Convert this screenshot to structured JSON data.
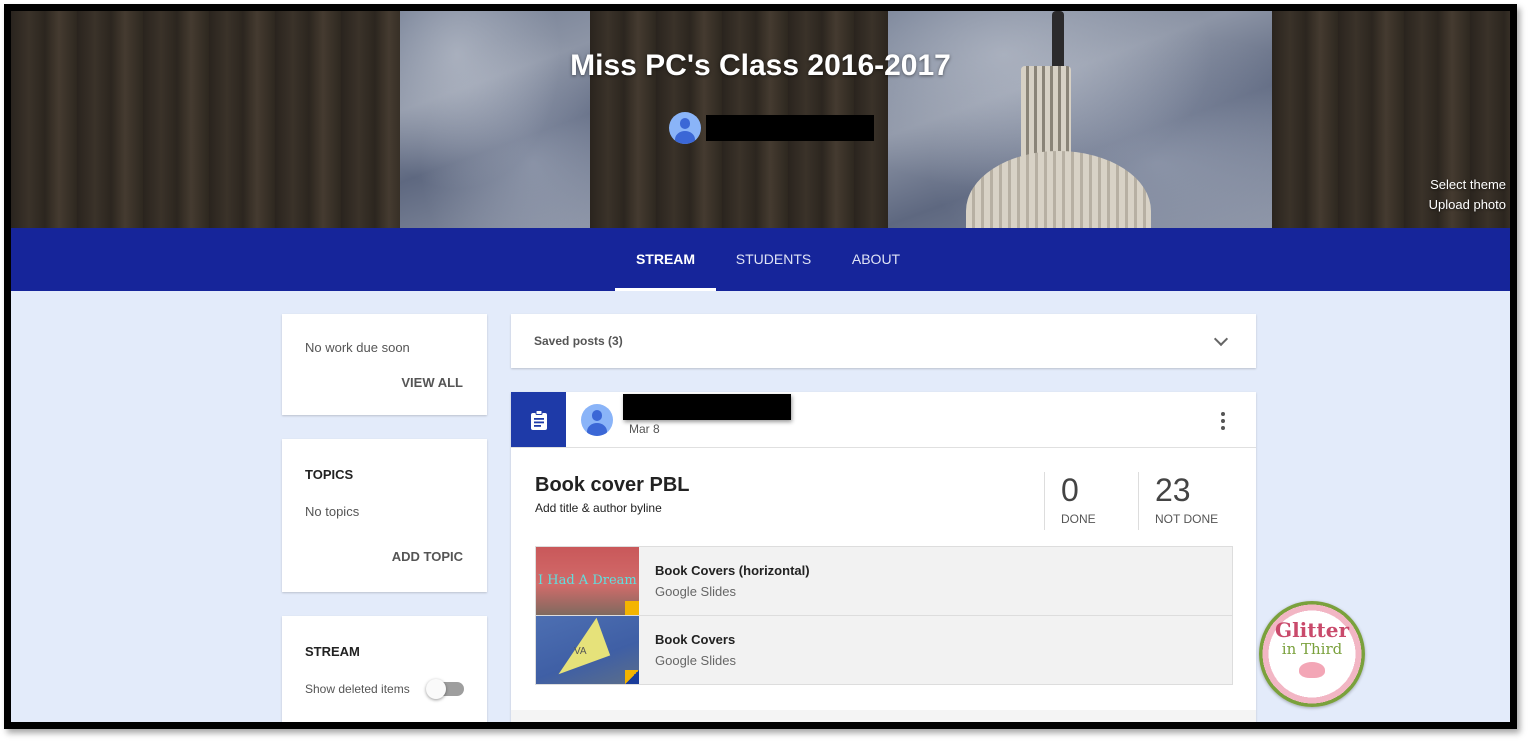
{
  "header": {
    "class_title": "Miss PC's Class 2016-2017",
    "teacher_name_redacted": "",
    "links": [
      "Select theme",
      "Upload photo"
    ]
  },
  "tabs": [
    {
      "label": "STREAM",
      "active": true
    },
    {
      "label": "STUDENTS",
      "active": false
    },
    {
      "label": "ABOUT",
      "active": false
    }
  ],
  "sidebar": {
    "upcoming": {
      "text": "No work due soon",
      "button": "VIEW ALL"
    },
    "topics": {
      "heading": "TOPICS",
      "text": "No topics",
      "button": "ADD TOPIC"
    },
    "stream": {
      "heading": "STREAM",
      "toggle_label": "Show deleted items",
      "toggle_on": false
    }
  },
  "saved_posts": {
    "label": "Saved posts (3)"
  },
  "post": {
    "date": "Mar 8",
    "title": "Book cover PBL",
    "description": "Add title & author byline",
    "stats": [
      {
        "value": "0",
        "label": "DONE"
      },
      {
        "value": "23",
        "label": "NOT DONE"
      }
    ],
    "attachments": [
      {
        "title": "Book Covers (horizontal)",
        "type": "Google Slides",
        "thumb_text": "I Had A Dream"
      },
      {
        "title": "Book Covers",
        "type": "Google Slides",
        "thumb_text": "VA"
      }
    ]
  },
  "watermark": {
    "line1": "Glitter",
    "line2": "in Third"
  },
  "colors": {
    "tabbar": "#16259a",
    "accent": "#1e3aa8",
    "background": "#e3ebfa"
  }
}
